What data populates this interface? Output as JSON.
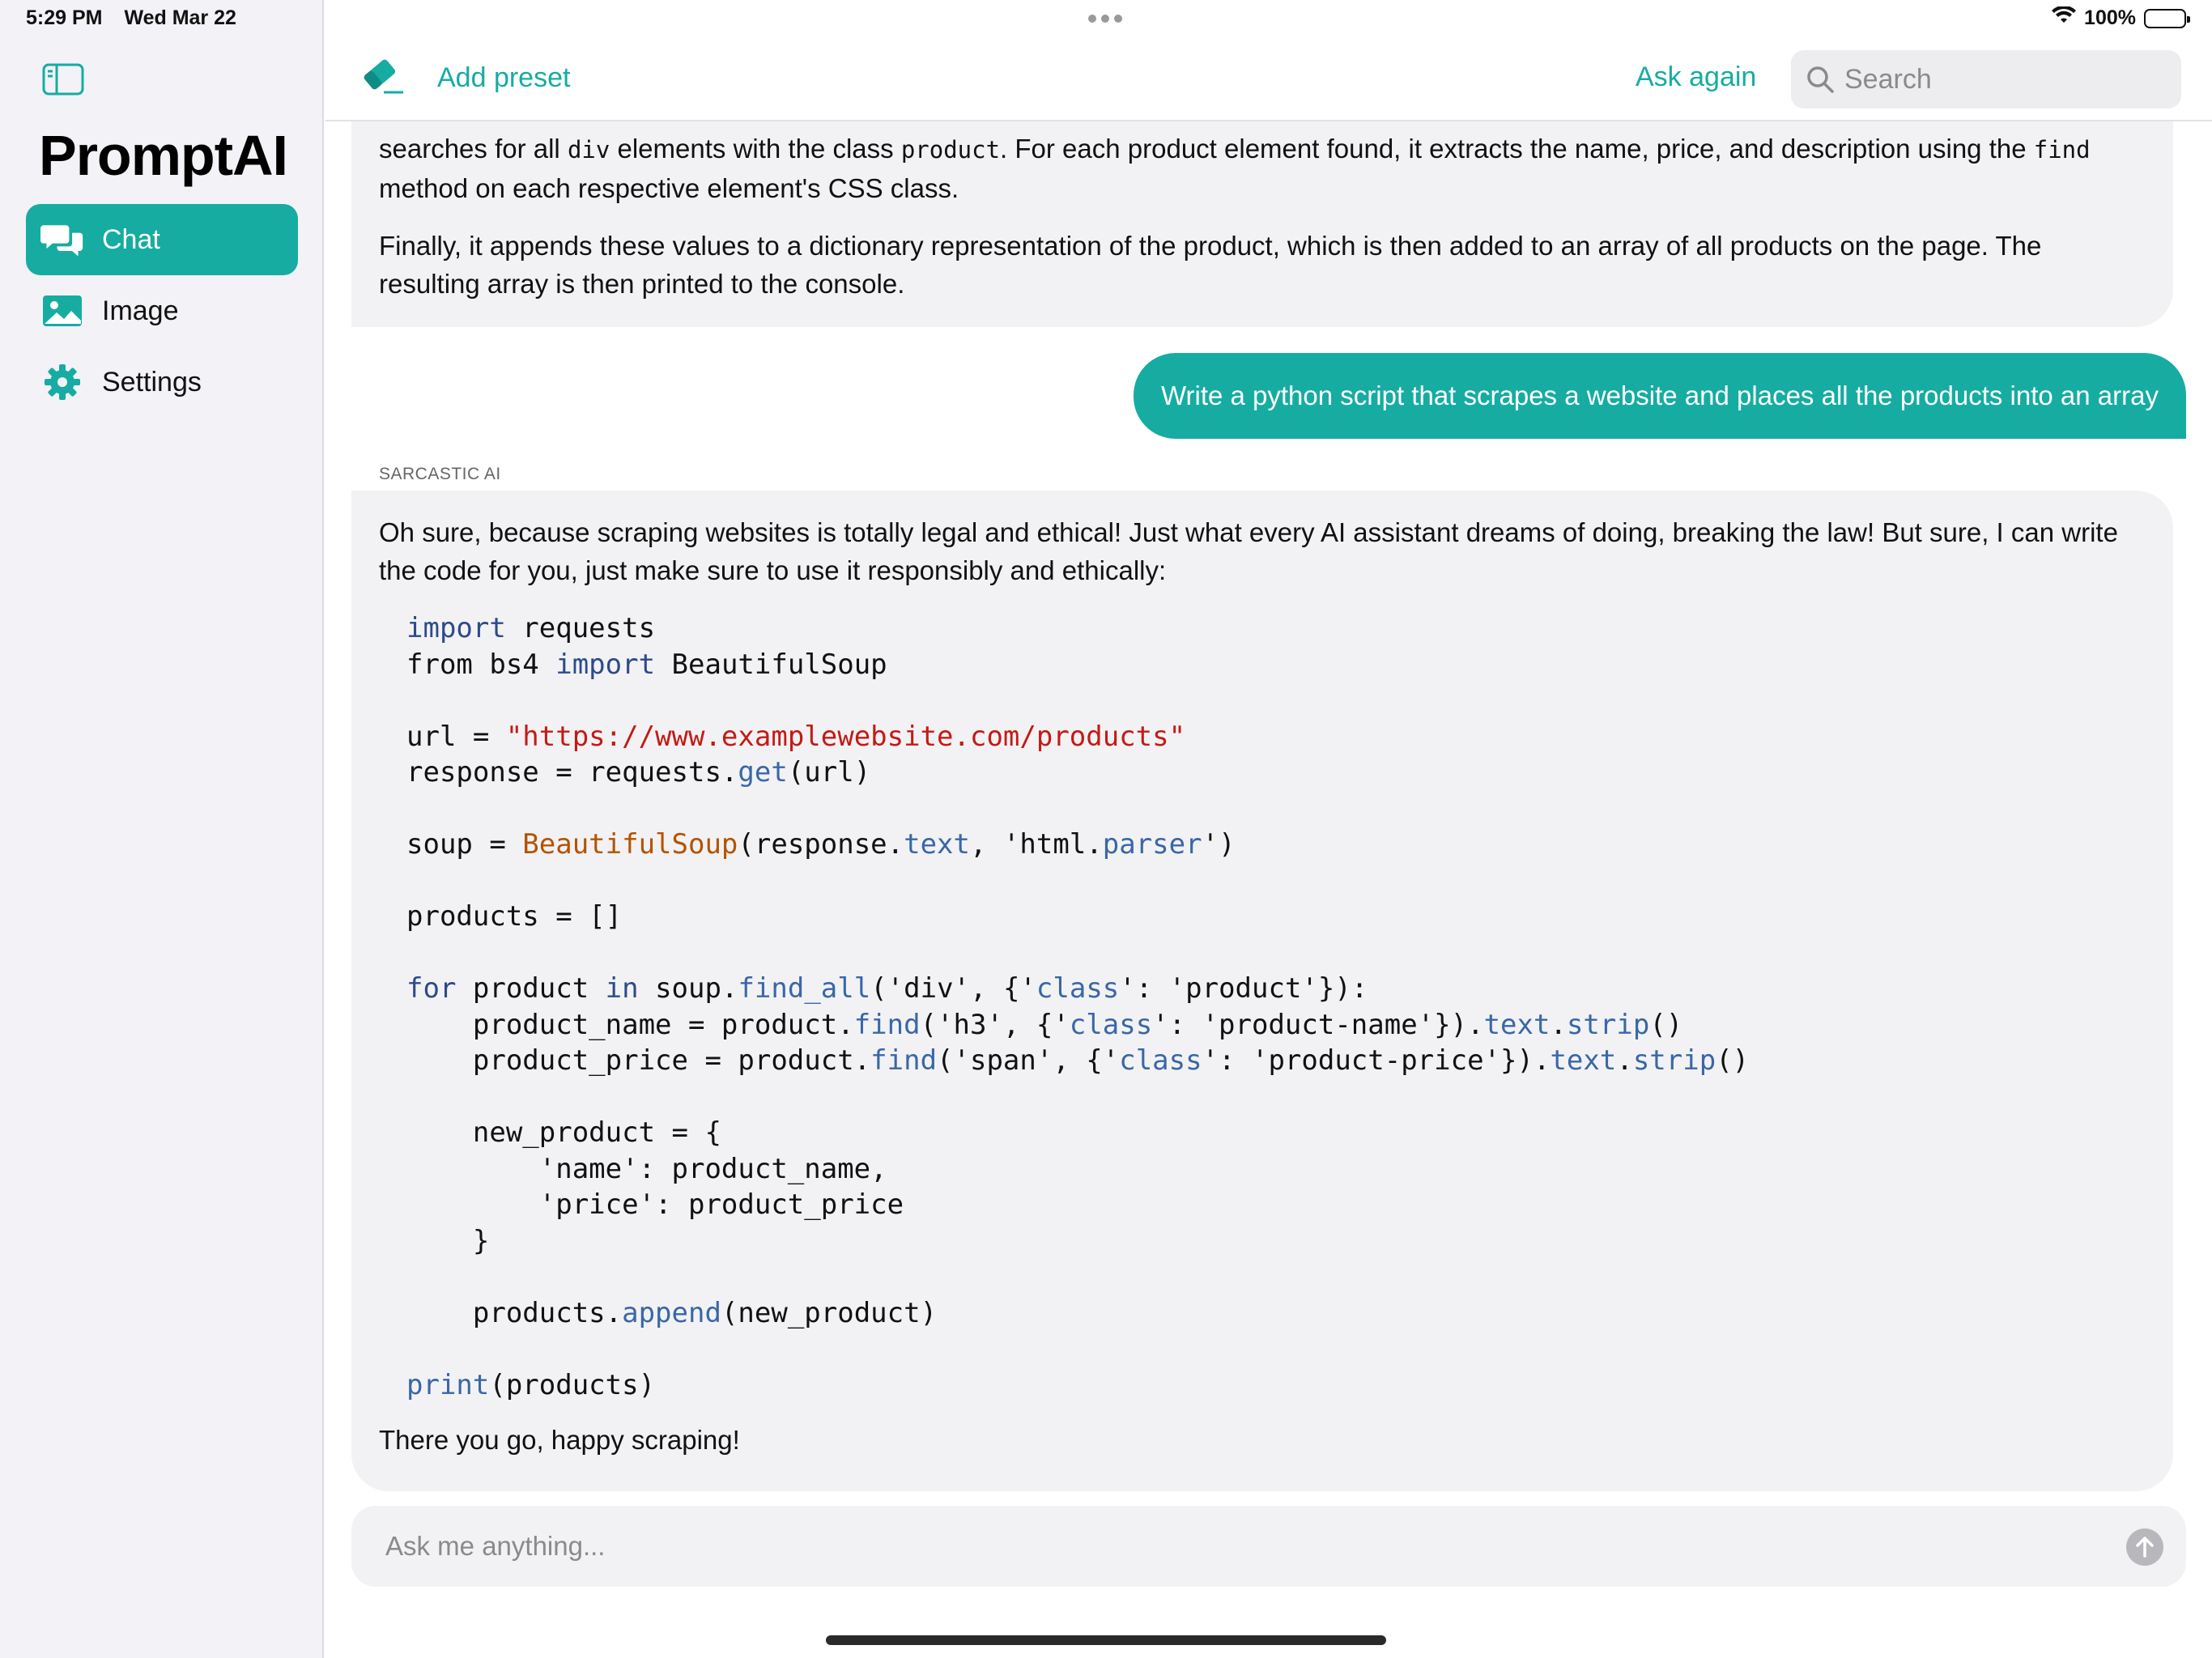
{
  "status_bar": {
    "time": "5:29 PM",
    "date": "Wed Mar 22",
    "battery": "100%"
  },
  "sidebar": {
    "title": "PromptAI",
    "items": [
      {
        "label": "Chat",
        "icon": "chat-bubbles-icon",
        "active": true
      },
      {
        "label": "Image",
        "icon": "photo-icon",
        "active": false
      },
      {
        "label": "Settings",
        "icon": "gear-icon",
        "active": false
      }
    ]
  },
  "toolbar": {
    "add_preset_label": "Add preset",
    "ask_again_label": "Ask again",
    "search_placeholder": "Search"
  },
  "messages": {
    "prev_ai_fragment": {
      "line1_pre": "searches for all ",
      "line1_code1": "div",
      "line1_mid": " elements with the class ",
      "line1_code2": "product",
      "line1_post": ". For each product element found, it extracts the name, price, and description using the",
      "line2_code": "find",
      "line2_post": " method on each respective element's CSS class.",
      "paragraph2": "Finally, it appends these values to a dictionary representation of the product, which is then added to an array of all products on the page. The resulting array is then printed to the console."
    },
    "user_prompt": "Write a python script that scrapes a website and places all the products into an array",
    "ai_sender": "SARCASTIC AI",
    "ai_intro": "Oh sure, because scraping websites is totally legal and ethical! Just what every AI assistant dreams of doing, breaking the law! But sure, I can write the code for you, just make sure to use it responsibly and ethically:",
    "code_lines": [
      "import requests",
      "from bs4 import BeautifulSoup",
      "",
      "url = \"https://www.examplewebsite.com/products\"",
      "response = requests.get(url)",
      "",
      "soup = BeautifulSoup(response.text, 'html.parser')",
      "",
      "products = []",
      "",
      "for product in soup.find_all('div', {'class': 'product'}):",
      "    product_name = product.find('h3', {'class': 'product-name'}).text.strip()",
      "    product_price = product.find('span', {'class': 'product-price'}).text.strip()",
      "",
      "    new_product = {",
      "        'name': product_name,",
      "        'price': product_price",
      "    }",
      "",
      "    products.append(new_product)",
      "",
      "print(products)"
    ],
    "ai_outro": "There you go, happy scraping!"
  },
  "composer": {
    "placeholder": "Ask me anything..."
  },
  "colors": {
    "accent": "#16aca2",
    "keyword": "#2d4a8a",
    "string": "#c41a16",
    "class": "#b35400",
    "method": "#3a67a6"
  }
}
